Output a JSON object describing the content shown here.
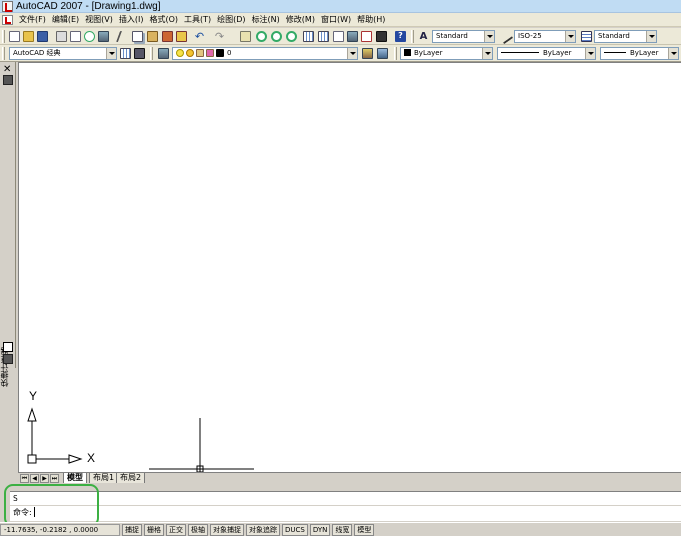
{
  "window": {
    "title": "AutoCAD 2007 - [Drawing1.dwg]"
  },
  "menu": [
    "文件(F)",
    "编辑(E)",
    "视图(V)",
    "插入(I)",
    "格式(O)",
    "工具(T)",
    "绘图(D)",
    "标注(N)",
    "修改(M)",
    "窗口(W)",
    "帮助(H)"
  ],
  "styles": {
    "text_style": "Standard",
    "dim_style": "ISO-25",
    "table_style": "Standard"
  },
  "workspace": "AutoCAD 经典",
  "layer": {
    "name": "0"
  },
  "properties": {
    "color": "ByLayer",
    "linetype": "ByLayer",
    "lineweight": "ByLayer"
  },
  "palette": {
    "label": "快捷计算器"
  },
  "ucs": {
    "x_label": "X",
    "y_label": "Y"
  },
  "layout_tabs": [
    "模型",
    "布局1",
    "布局2"
  ],
  "command": {
    "history": "S",
    "prompt": "命令:"
  },
  "status": {
    "coordinates": "-11.7635, -0.2182 , 0.0000",
    "toggles": [
      "捕捉",
      "栅格",
      "正交",
      "极轴",
      "对象捕捉",
      "对象追踪",
      "DUCS",
      "DYN",
      "线宽",
      "模型"
    ]
  },
  "icons": {
    "app": "autocad-icon",
    "highlight_color": "#3cb043"
  }
}
